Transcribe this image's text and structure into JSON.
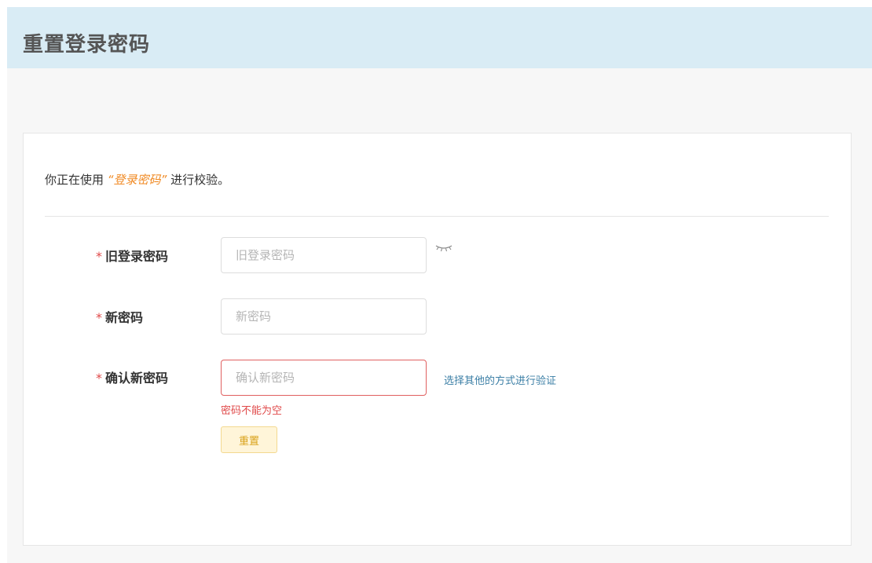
{
  "header": {
    "title": "重置登录密码"
  },
  "intro": {
    "prefix": "你正在使用 ",
    "method": "“登录密码”",
    "suffix": " 进行校验。"
  },
  "form": {
    "required_mark": "*",
    "old_password": {
      "label": "旧登录密码",
      "placeholder": "旧登录密码",
      "value": ""
    },
    "new_password": {
      "label": "新密码",
      "placeholder": "新密码",
      "value": ""
    },
    "confirm_password": {
      "label": "确认新密码",
      "placeholder": "确认新密码",
      "value": "",
      "error": "密码不能为空"
    },
    "alt_verify_link": "选择其他的方式进行验证",
    "reset_button": "重置"
  },
  "icons": {
    "password_toggle": "eye-closed-icon"
  },
  "colors": {
    "header_bg": "#d9ecf5",
    "accent_orange": "#f08a24",
    "error_red": "#e04a4a",
    "link_blue": "#3c7fa6",
    "button_bg": "#fff5d9",
    "button_text": "#d9a21a"
  }
}
